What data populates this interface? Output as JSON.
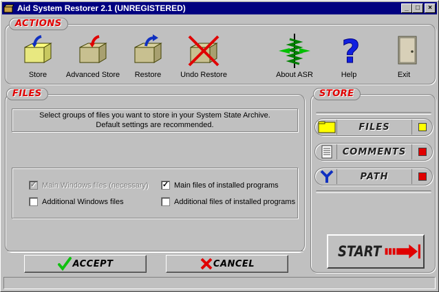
{
  "window": {
    "title": "Aid System Restorer 2.1 (UNREGISTERED)",
    "controls": [
      "minimize",
      "maximize",
      "close"
    ]
  },
  "actions": {
    "section_label": "ACTIONS",
    "items": [
      {
        "label": "Store",
        "icon": "store-box-icon"
      },
      {
        "label": "Advanced Store",
        "icon": "advanced-store-box-icon"
      },
      {
        "label": "Restore",
        "icon": "restore-box-icon"
      },
      {
        "label": "Undo Restore",
        "icon": "undo-restore-icon"
      },
      {
        "label": "About ASR",
        "icon": "spring-icon"
      },
      {
        "label": "Help",
        "icon": "question-mark-icon"
      },
      {
        "label": "Exit",
        "icon": "door-icon"
      }
    ]
  },
  "files": {
    "section_label": "FILES",
    "info_line1": "Select groups of files you want to store in your System State Archive.",
    "info_line2": "Default settings are recommended.",
    "checkboxes": [
      {
        "label": "Main Windows files (necessary)",
        "checked": true,
        "disabled": true
      },
      {
        "label": "Main files of installed programs",
        "checked": true,
        "disabled": false
      },
      {
        "label": "Additional Windows files",
        "checked": false,
        "disabled": false
      },
      {
        "label": "Additional files of installed programs",
        "checked": false,
        "disabled": false
      }
    ],
    "accept_label": "ACCEPT",
    "cancel_label": "CANCEL"
  },
  "store": {
    "section_label": "STORE",
    "buttons": [
      {
        "label": "FILES",
        "icon": "folder-icon",
        "status_color": "#ffff00"
      },
      {
        "label": "COMMENTS",
        "icon": "notepad-icon",
        "status_color": "#e00000"
      },
      {
        "label": "PATH",
        "icon": "fork-icon",
        "status_color": "#e00000"
      }
    ],
    "start_label": "START"
  },
  "colors": {
    "accent_red": "#e00000",
    "title_bar": "#000080",
    "face": "#c0c0c0"
  }
}
